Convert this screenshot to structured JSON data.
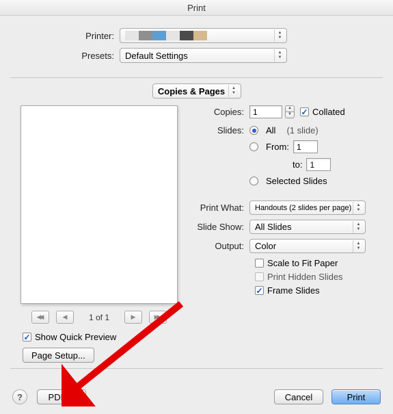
{
  "window": {
    "title": "Print"
  },
  "top": {
    "printer_label": "Printer:",
    "presets_label": "Presets:",
    "presets_value": "Default Settings"
  },
  "section_selector": {
    "value": "Copies & Pages"
  },
  "preview": {
    "page_indicator": "1 of 1",
    "show_quick_preview_label": "Show Quick Preview",
    "page_setup_label": "Page Setup..."
  },
  "options": {
    "copies_label": "Copies:",
    "copies_value": "1",
    "collated_label": "Collated",
    "slides_label": "Slides:",
    "all_label": "All",
    "slide_count_hint": "(1 slide)",
    "from_label": "From:",
    "from_value": "1",
    "to_label": "to:",
    "to_value": "1",
    "selected_slides_label": "Selected Slides",
    "print_what_label": "Print What:",
    "print_what_value": "Handouts (2 slides per page)",
    "slide_show_label": "Slide Show:",
    "slide_show_value": "All Slides",
    "output_label": "Output:",
    "output_value": "Color",
    "scale_label": "Scale to Fit Paper",
    "hidden_label": "Print Hidden Slides",
    "frame_label": "Frame Slides"
  },
  "footer": {
    "pdf_label": "PDF",
    "cancel_label": "Cancel",
    "print_label": "Print"
  }
}
